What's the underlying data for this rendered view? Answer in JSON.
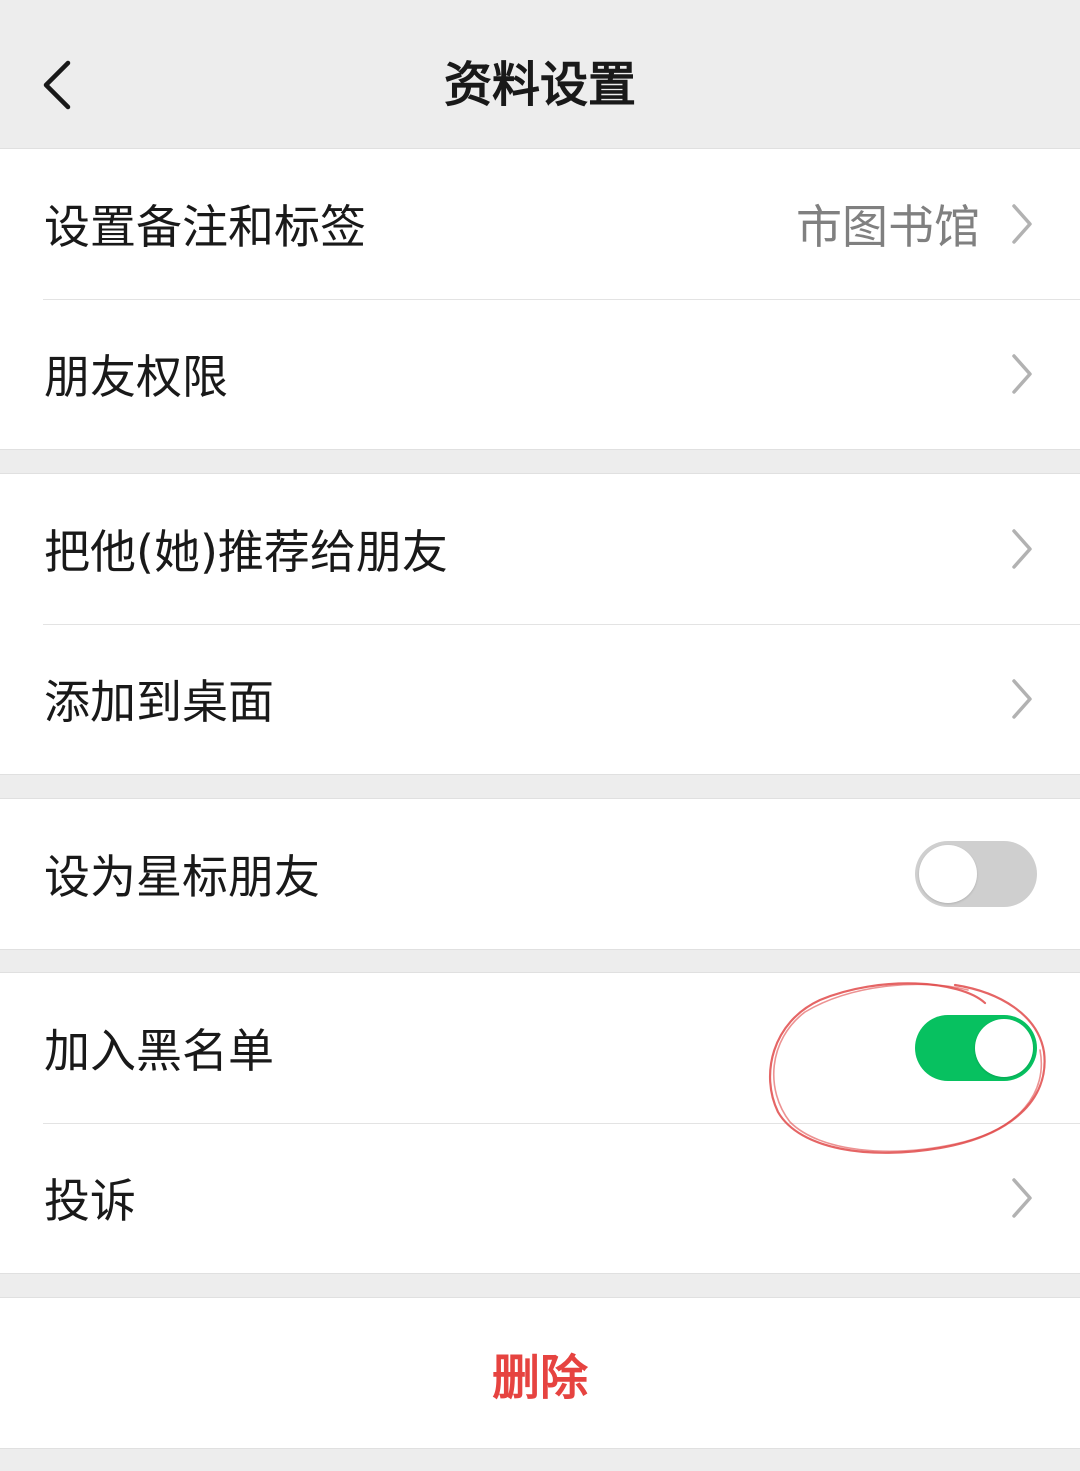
{
  "navbar": {
    "title": "资料设置",
    "back_icon": "chevron-left-icon"
  },
  "groups": [
    {
      "rows": [
        {
          "label": "设置备注和标签",
          "value": "市图书馆",
          "control": "chevron"
        },
        {
          "label": "朋友权限",
          "value": "",
          "control": "chevron"
        }
      ]
    },
    {
      "rows": [
        {
          "label": "把他(她)推荐给朋友",
          "value": "",
          "control": "chevron"
        },
        {
          "label": "添加到桌面",
          "value": "",
          "control": "chevron"
        }
      ]
    },
    {
      "rows": [
        {
          "label": "设为星标朋友",
          "control": "switch",
          "checked": false
        }
      ]
    },
    {
      "rows": [
        {
          "label": "加入黑名单",
          "control": "switch",
          "checked": true
        },
        {
          "label": "投诉",
          "value": "",
          "control": "chevron"
        }
      ]
    }
  ],
  "delete_button": {
    "label": "删除"
  },
  "colors": {
    "background": "#ededed",
    "switch_on": "#07c160",
    "switch_off": "#cfcfcf",
    "danger": "#e64340",
    "annotation": "#e04a4a"
  },
  "annotation": {
    "shape": "hand-drawn-circle",
    "target": "加入黑名单 switch"
  }
}
